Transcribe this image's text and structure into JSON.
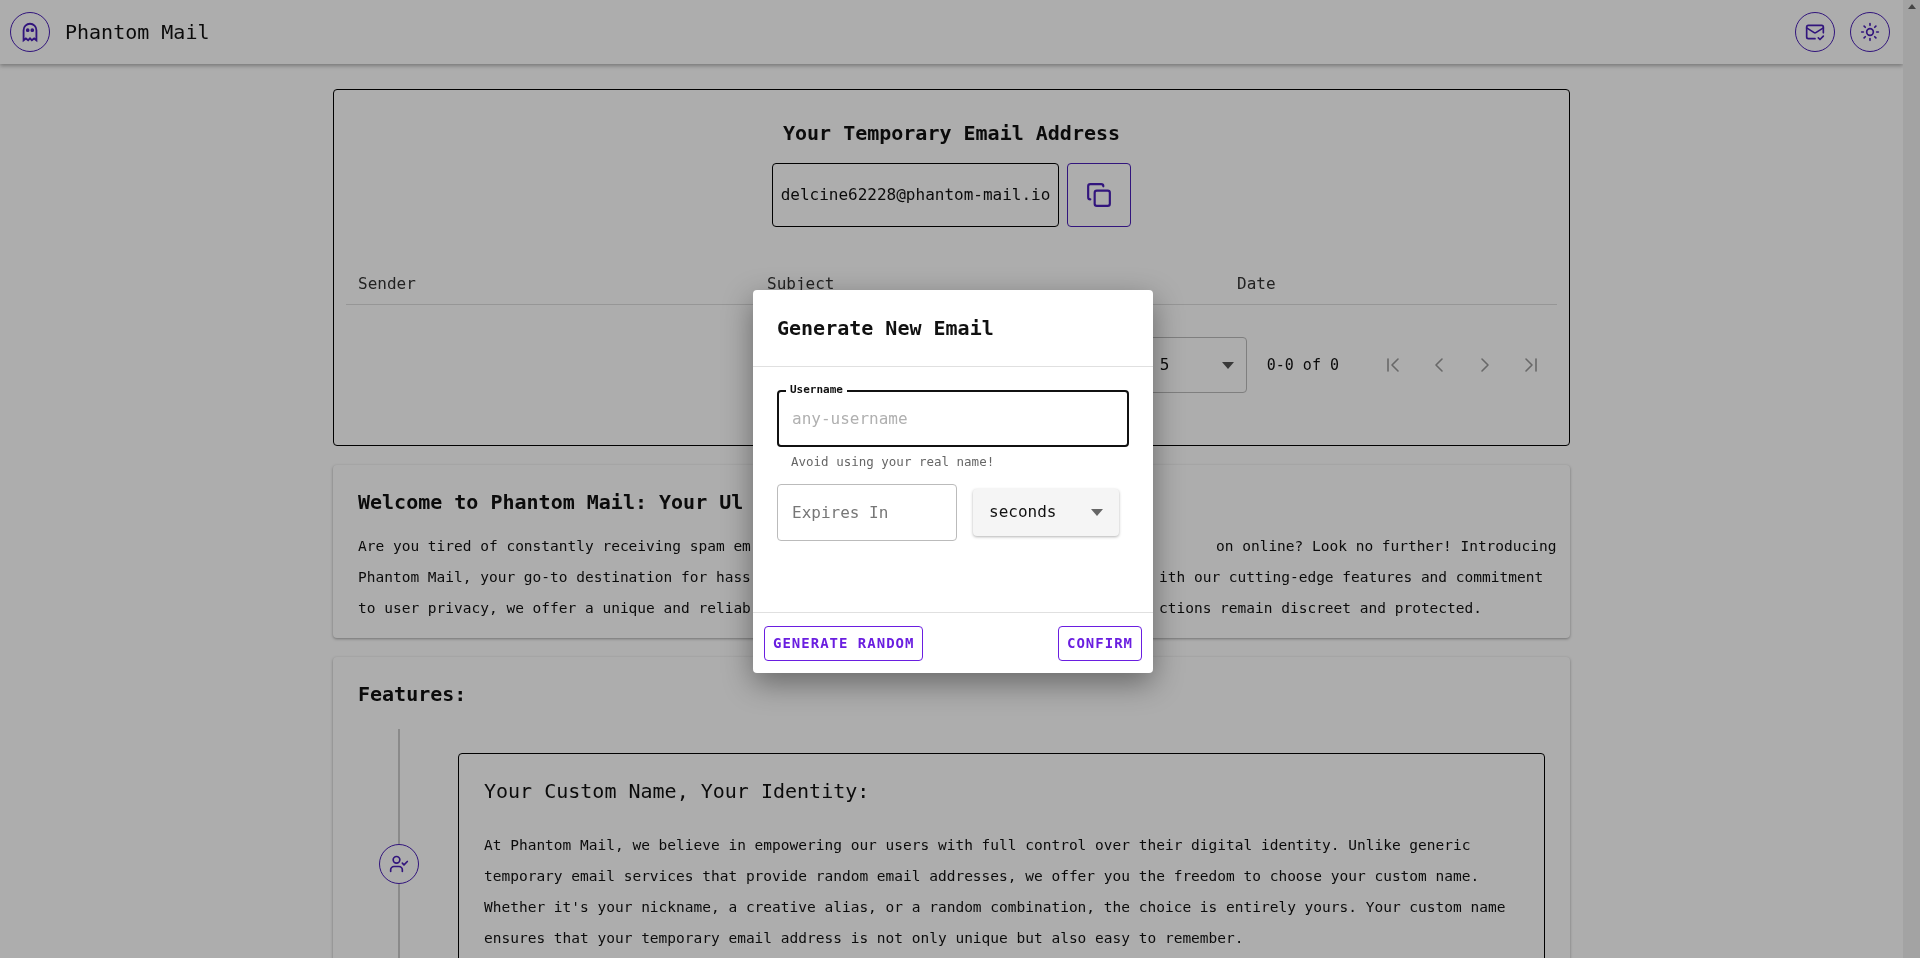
{
  "app": {
    "name": "Phantom Mail"
  },
  "address_card": {
    "title": "Your Temporary Email Address",
    "email": "delcine62228@phantom-mail.io",
    "table": {
      "columns": [
        "Sender",
        "Subject",
        "Date"
      ]
    },
    "pagination": {
      "rows_per_page": "5",
      "range": "0-0 of 0",
      "nav": [
        {
          "kind": "first",
          "disabled": true
        },
        {
          "kind": "prev",
          "disabled": true
        },
        {
          "kind": "next",
          "disabled": true
        },
        {
          "kind": "last",
          "disabled": true
        }
      ]
    }
  },
  "welcome": {
    "title": "Welcome to Phantom Mail: Your Ul",
    "lines": [
      {
        "left": "Are you tired of constantly receiving spam em",
        "right": "on online? Look no further! Introducing"
      },
      {
        "left": "Phantom Mail, your go-to destination for hass",
        "right": "ith our cutting-edge features and commitment"
      },
      {
        "left": "to user privacy, we offer a unique and reliab",
        "right": "ctions remain discreet and protected."
      }
    ]
  },
  "features": {
    "title": "Features:",
    "items": [
      {
        "title": "Your Custom Name, Your Identity:",
        "text": "At Phantom Mail, we believe in empowering our users with full control over their digital identity. Unlike generic temporary email services that provide random email addresses, we offer you the freedom to choose your custom name. Whether it's your nickname, a creative alias, or a random combination, the choice is entirely yours. Your custom name ensures that your temporary email address is not only unique but also easy to remember."
      }
    ]
  },
  "dialog": {
    "title": "Generate New Email",
    "username": {
      "label": "Username",
      "placeholder": "any-username",
      "helper": "Avoid using your real name!"
    },
    "expires": {
      "placeholder": "Expires In"
    },
    "unit": {
      "value": "seconds"
    },
    "buttons": [
      {
        "label": "GENERATE RANDOM"
      },
      {
        "label": "CONFIRM"
      }
    ]
  }
}
